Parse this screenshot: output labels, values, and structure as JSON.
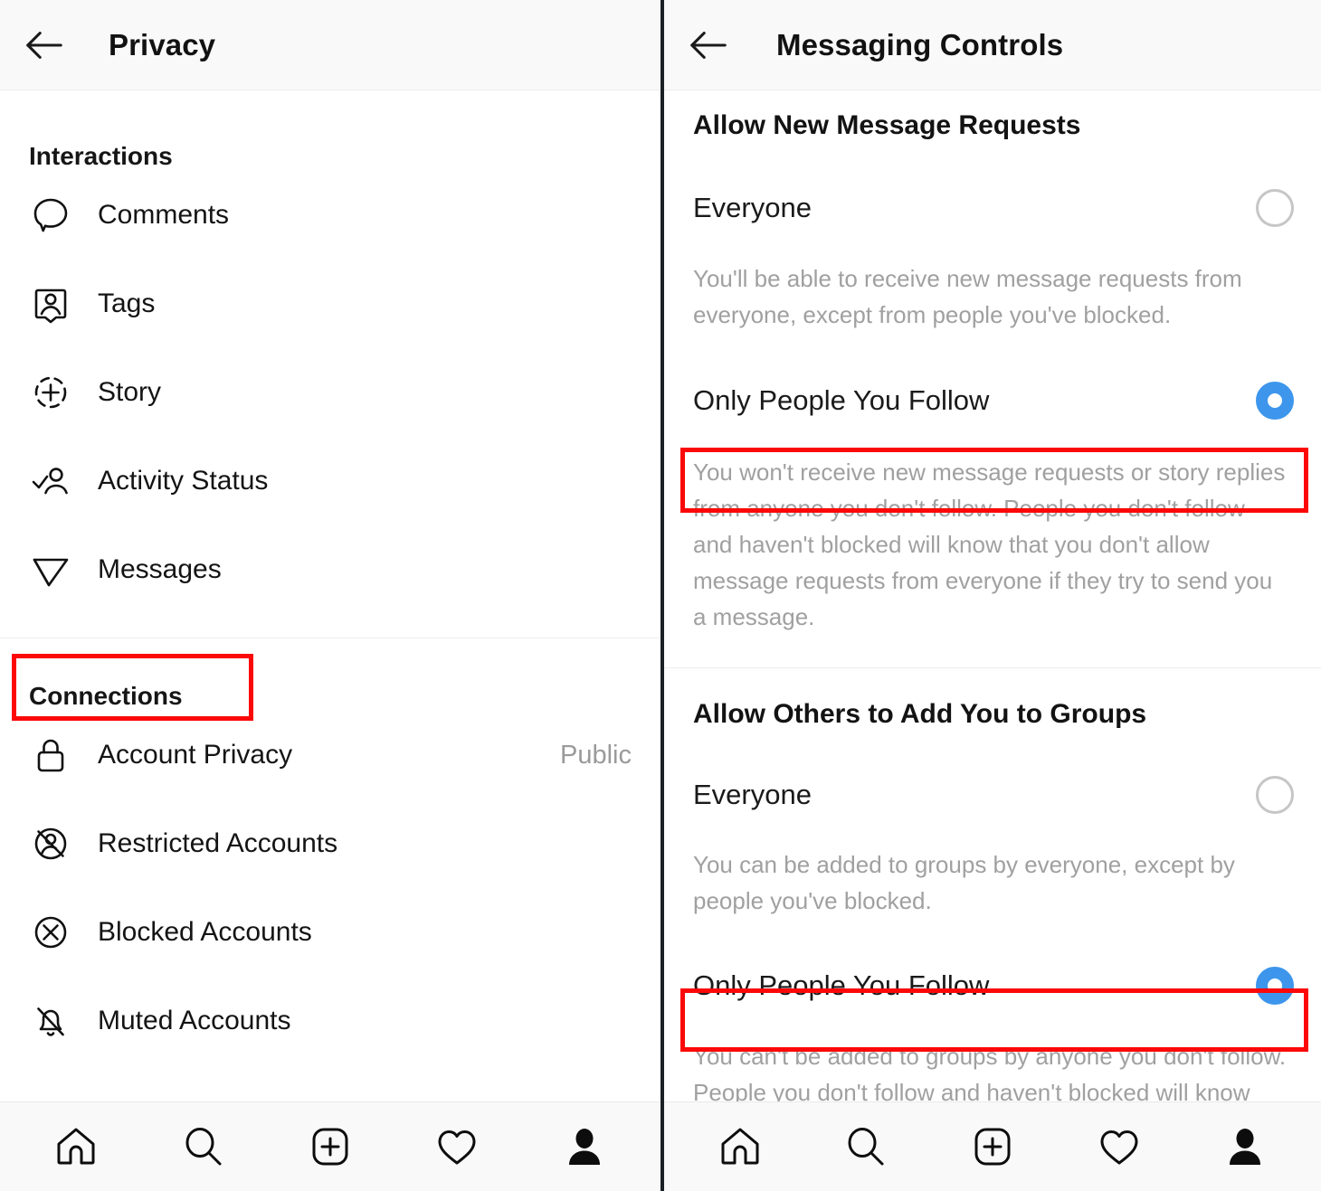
{
  "left_panel": {
    "header": {
      "back_icon": "back-arrow-icon",
      "title": "Privacy"
    },
    "sections": [
      {
        "title": "Interactions",
        "items": [
          {
            "icon": "comment-bubble-icon",
            "label": "Comments",
            "value": ""
          },
          {
            "icon": "tags-icon",
            "label": "Tags",
            "value": ""
          },
          {
            "icon": "story-plus-icon",
            "label": "Story",
            "value": ""
          },
          {
            "icon": "activity-status-icon",
            "label": "Activity Status",
            "value": ""
          },
          {
            "icon": "paper-plane-icon",
            "label": "Messages",
            "value": ""
          }
        ]
      },
      {
        "title": "Connections",
        "items": [
          {
            "icon": "lock-icon",
            "label": "Account Privacy",
            "value": "Public"
          },
          {
            "icon": "restricted-account-icon",
            "label": "Restricted Accounts",
            "value": ""
          },
          {
            "icon": "blocked-account-icon",
            "label": "Blocked Accounts",
            "value": ""
          },
          {
            "icon": "muted-bell-icon",
            "label": "Muted Accounts",
            "value": ""
          }
        ]
      }
    ],
    "highlight": {
      "target": "Messages",
      "color": "#fc0808"
    }
  },
  "right_panel": {
    "header": {
      "back_icon": "back-arrow-icon",
      "title": "Messaging Controls"
    },
    "sections": [
      {
        "title": "Allow New Message Requests",
        "options": [
          {
            "label": "Everyone",
            "selected": false,
            "description": "You'll be able to receive new message requests from everyone, except from people you've blocked."
          },
          {
            "label": "Only People You Follow",
            "selected": true,
            "description": "You won't receive new message requests or story replies from anyone you don't follow. People you don't follow and haven't blocked will know that you don't allow message requests from everyone if they try to send you a message."
          }
        ]
      },
      {
        "title": "Allow Others to Add You to Groups",
        "options": [
          {
            "label": "Everyone",
            "selected": false,
            "description": "You can be added to groups by everyone, except by people you've blocked."
          },
          {
            "label": "Only People You Follow",
            "selected": true,
            "description": "You can't be added to groups by anyone you don't follow. People you don't follow and haven't blocked will know that you don't allow everyone to add you to groups if they try to."
          }
        ]
      }
    ],
    "highlights": [
      {
        "target": "Only People You Follow (message requests)",
        "color": "#fc0808"
      },
      {
        "target": "Only People You Follow (groups)",
        "color": "#fc0808"
      }
    ]
  },
  "bottom_nav": {
    "items": [
      {
        "icon": "home-icon",
        "label": "Home"
      },
      {
        "icon": "search-icon",
        "label": "Search"
      },
      {
        "icon": "add-post-icon",
        "label": "Create"
      },
      {
        "icon": "heart-icon",
        "label": "Activity"
      },
      {
        "icon": "profile-icon",
        "label": "Profile"
      }
    ]
  },
  "colors": {
    "accent_blue": "#3d96ec",
    "highlight_red": "#fc0808",
    "radio_off": "#c6c6c6",
    "muted_text": "#a0a0a0",
    "divider": "#ededed",
    "header_bg": "#f9f9f9"
  }
}
